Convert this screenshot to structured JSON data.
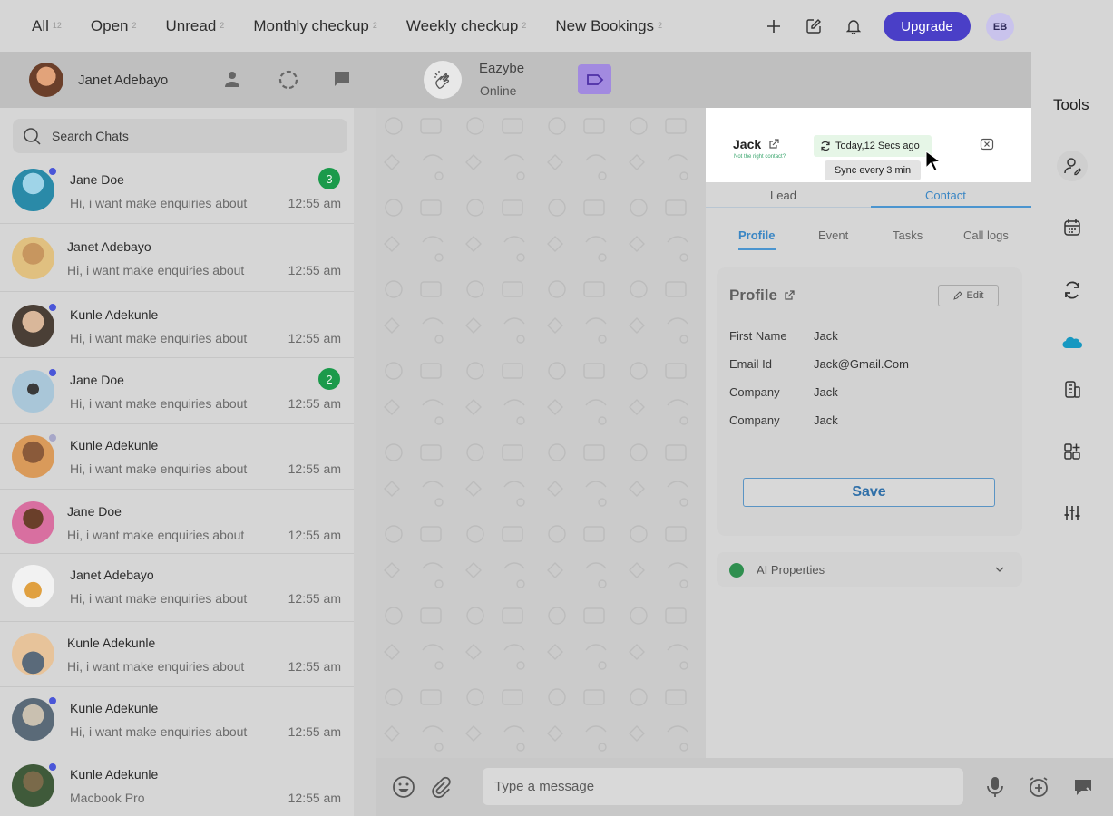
{
  "top_tabs": [
    {
      "label": "All",
      "count": "12"
    },
    {
      "label": "Open",
      "count": "2"
    },
    {
      "label": "Unread",
      "count": "2"
    },
    {
      "label": "Monthly checkup",
      "count": "2"
    },
    {
      "label": "Weekly checkup",
      "count": "2"
    },
    {
      "label": "New Bookings",
      "count": "2"
    }
  ],
  "topbar": {
    "upgrade_label": "Upgrade",
    "user_initials": "EB",
    "accent": "#4a3fc7"
  },
  "header": {
    "agent_name": "Janet Adebayo",
    "contact_name": "Eazybe",
    "contact_status": "Online"
  },
  "search": {
    "placeholder": "Search Chats"
  },
  "chats": [
    {
      "name": "Jane Doe",
      "message": "Hi, i want make enquiries about",
      "time": "12:55 am",
      "badge": "3",
      "unread_dot": true
    },
    {
      "name": "Janet Adebayo",
      "message": "Hi, i want make enquiries about",
      "time": "12:55 am",
      "badge": "",
      "unread_dot": false
    },
    {
      "name": "Kunle Adekunle",
      "message": "Hi, i want make enquiries about",
      "time": "12:55 am",
      "badge": "",
      "unread_dot": true
    },
    {
      "name": "Jane Doe",
      "message": "Hi, i want make enquiries about",
      "time": "12:55 am",
      "badge": "2",
      "unread_dot": true
    },
    {
      "name": "Kunle Adekunle",
      "message": "Hi, i want make enquiries about",
      "time": "12:55 am",
      "badge": "",
      "unread_dot": true
    },
    {
      "name": "Jane Doe",
      "message": "Hi, i want make enquiries about",
      "time": "12:55 am",
      "badge": "",
      "unread_dot": false
    },
    {
      "name": "Janet Adebayo",
      "message": "Hi, i want make enquiries about",
      "time": "12:55 am",
      "badge": "",
      "unread_dot": false
    },
    {
      "name": "Kunle Adekunle",
      "message": "Hi, i want make enquiries about",
      "time": "12:55 am",
      "badge": "",
      "unread_dot": false
    },
    {
      "name": "Kunle Adekunle",
      "message": "Hi, i want make enquiries about",
      "time": "12:55 am",
      "badge": "",
      "unread_dot": true
    },
    {
      "name": "Kunle Adekunle",
      "message": "Macbook Pro",
      "time": "12:55 am",
      "badge": "",
      "unread_dot": true
    }
  ],
  "popup": {
    "name": "Jack",
    "not_right_link": "Not the right contact?",
    "sync_status": "Today,12 Secs ago",
    "sync_tooltip": "Sync every 3 min"
  },
  "panel": {
    "lc_tabs": [
      "Lead",
      "Contact"
    ],
    "sub_tabs": [
      "Profile",
      "Event",
      "Tasks",
      "Call logs"
    ],
    "profile_title": "Profile",
    "edit_label": "Edit",
    "fields": [
      {
        "label": "First Name",
        "value": "Jack"
      },
      {
        "label": "Email Id",
        "value": "Jack@Gmail.Com"
      },
      {
        "label": "Company",
        "value": "Jack"
      },
      {
        "label": "Company",
        "value": "Jack"
      }
    ],
    "save_label": "Save",
    "ai_properties_label": "AI Properties"
  },
  "tools": {
    "title": "Tools"
  },
  "composer": {
    "placeholder": "Type a message"
  }
}
